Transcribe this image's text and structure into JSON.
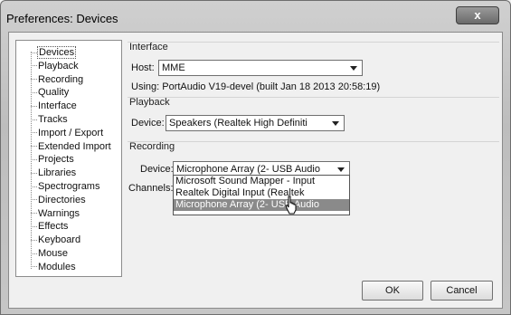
{
  "window": {
    "title": "Preferences: Devices",
    "close_label": "x"
  },
  "tree": {
    "items": [
      "Devices",
      "Playback",
      "Recording",
      "Quality",
      "Interface",
      "Tracks",
      "Import / Export",
      "Extended Import",
      "Projects",
      "Libraries",
      "Spectrograms",
      "Directories",
      "Warnings",
      "Effects",
      "Keyboard",
      "Mouse",
      "Modules"
    ],
    "selected": "Devices"
  },
  "interface": {
    "title": "Interface",
    "host_label": "Host:",
    "host_value": "MME",
    "using_text": "Using: PortAudio V19-devel (built Jan 18 2013 20:58:19)"
  },
  "playback": {
    "title": "Playback",
    "device_label": "Device:",
    "device_value": "Speakers (Realtek High Definiti"
  },
  "recording": {
    "title": "Recording",
    "device_label": "Device:",
    "device_value": "Microphone Array (2- USB Audio",
    "channels_label": "Channels:",
    "options": [
      "Microsoft Sound Mapper - Input",
      "Realtek Digital Input (Realtek",
      "Microphone Array (2- USB Audio"
    ],
    "highlighted_option": "Microphone Array (2- USB Audio"
  },
  "buttons": {
    "ok": "OK",
    "cancel": "Cancel"
  }
}
